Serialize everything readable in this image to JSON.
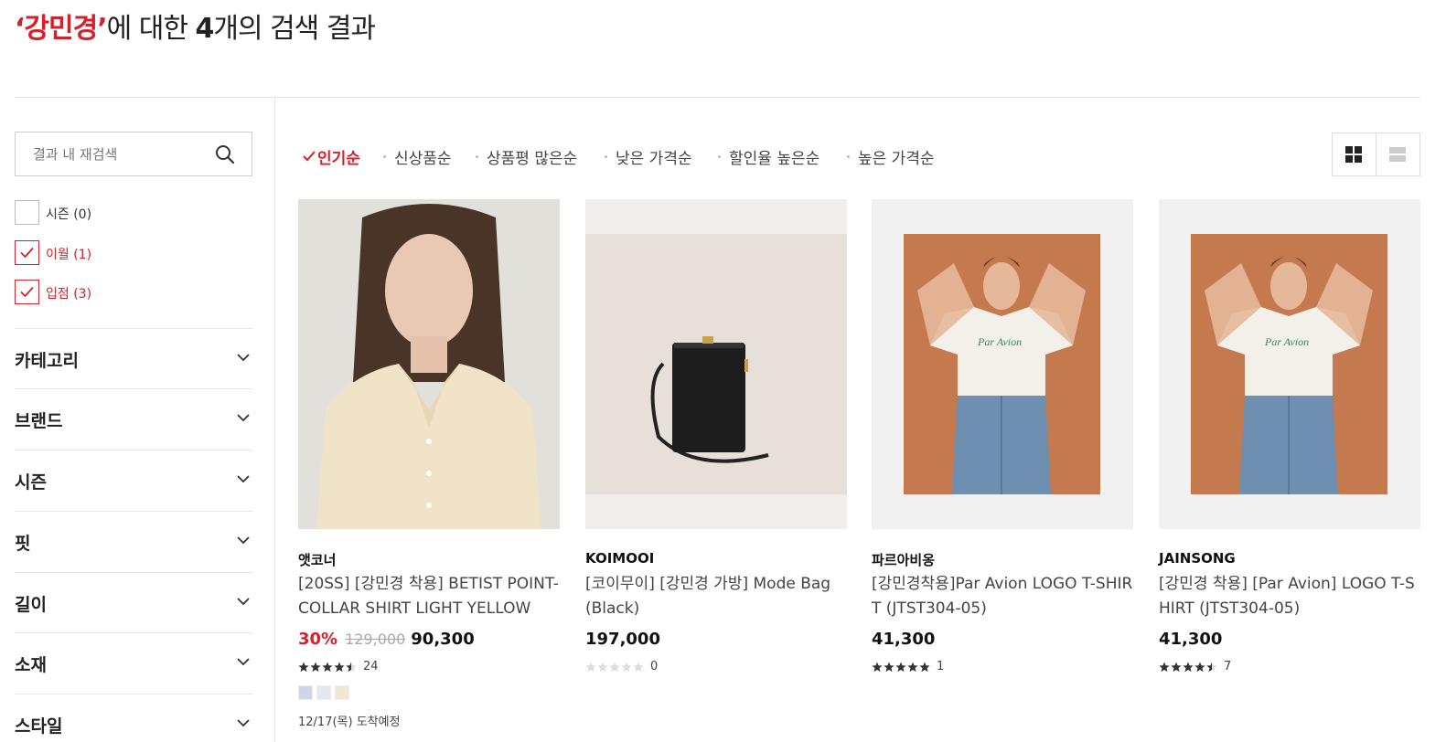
{
  "title": {
    "query": "‘강민경’",
    "prefix": "에 대한 ",
    "count": "4",
    "suffix": "개의 검색 결과"
  },
  "sidebar": {
    "search_placeholder": "결과 내 재검색",
    "filters": [
      {
        "label": "시즌 (0)",
        "checked": false
      },
      {
        "label": "이월 (1)",
        "checked": true
      },
      {
        "label": "입점 (3)",
        "checked": true
      }
    ],
    "accordions": [
      "카테고리",
      "브랜드",
      "시즌",
      "핏",
      "길이",
      "소재",
      "스타일"
    ]
  },
  "sort": {
    "options": [
      "인기순",
      "신상품순",
      "상품평 많은순",
      "낮은 가격순",
      "할인율 높은순",
      "높은 가격순"
    ],
    "active_index": 0
  },
  "products": [
    {
      "brand": "앳코너",
      "name": "[20SS] [강민경 착용] BETIST POINT-COLLAR SHIRT LIGHT YELLOW",
      "discount": "30%",
      "original_price": "129,000",
      "price": "90,300",
      "rating": 4.5,
      "review_count": "24",
      "swatches": [
        "#cdd6e6",
        "#e6e8ef",
        "#efe7d2"
      ],
      "delivery": "12/17(목) 도착예정"
    },
    {
      "brand": "KOIMOOI",
      "name": "[코이무이] [강민경 가방] Mode Bag (Black)",
      "price": "197,000",
      "rating": 0,
      "review_count": "0"
    },
    {
      "brand": "파르아비옹",
      "name": "[강민경착용]Par Avion LOGO T-SHIRT (JTST304-05)",
      "price": "41,300",
      "rating": 5,
      "review_count": "1",
      "print_text": "Par Avion"
    },
    {
      "brand": "JAINSONG",
      "name": "[강민경 착용] [Par Avion] LOGO T-SHIRT (JTST304-05)",
      "price": "41,300",
      "rating": 4.5,
      "review_count": "7",
      "print_text": "Par Avion"
    }
  ],
  "colors": {
    "accent": "#d6202a",
    "star": "#333333",
    "star_empty": "#dddddd"
  }
}
